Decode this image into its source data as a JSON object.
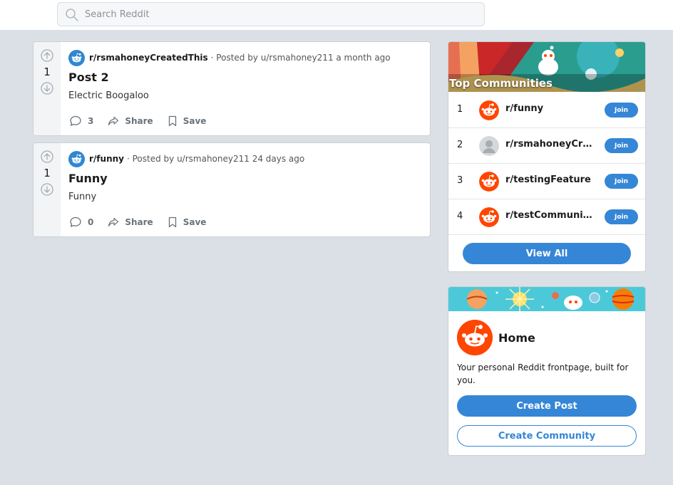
{
  "search": {
    "placeholder": "Search Reddit",
    "icon": "search-icon"
  },
  "posts": [
    {
      "score": "1",
      "subreddit": "r/rsmahoneyCreatedThis",
      "posted_by": "· Posted by u/rsmahoney211 a month ago",
      "title": "Post 2",
      "body": "Electric Boogaloo",
      "comments": "3",
      "share_label": "Share",
      "save_label": "Save"
    },
    {
      "score": "1",
      "subreddit": "r/funny",
      "posted_by": "· Posted by u/rsmahoney211 24 days ago",
      "title": "Funny",
      "body": "Funny",
      "comments": "0",
      "share_label": "Share",
      "save_label": "Save"
    }
  ],
  "top_communities": {
    "title": "Top Communities",
    "items": [
      {
        "rank": "1",
        "name": "r/funny",
        "avatar": "reddit-orange",
        "join_label": "Join"
      },
      {
        "rank": "2",
        "name": "r/rsmahoneyCreatedThis",
        "avatar": "default-gray",
        "join_label": "Join"
      },
      {
        "rank": "3",
        "name": "r/testingFeature",
        "avatar": "reddit-orange",
        "join_label": "Join"
      },
      {
        "rank": "4",
        "name": "r/testCommunity",
        "avatar": "reddit-orange",
        "join_label": "Join"
      }
    ],
    "view_all_label": "View All"
  },
  "home": {
    "title": "Home",
    "description": "Your personal Reddit frontpage, built for you.",
    "create_post_label": "Create Post",
    "create_community_label": "Create Community"
  },
  "colors": {
    "page_bg": "#dae0e6",
    "accent": "#3586d6",
    "reddit_orange": "#ff4500",
    "subreddit_avatar": "#2f87d1"
  }
}
